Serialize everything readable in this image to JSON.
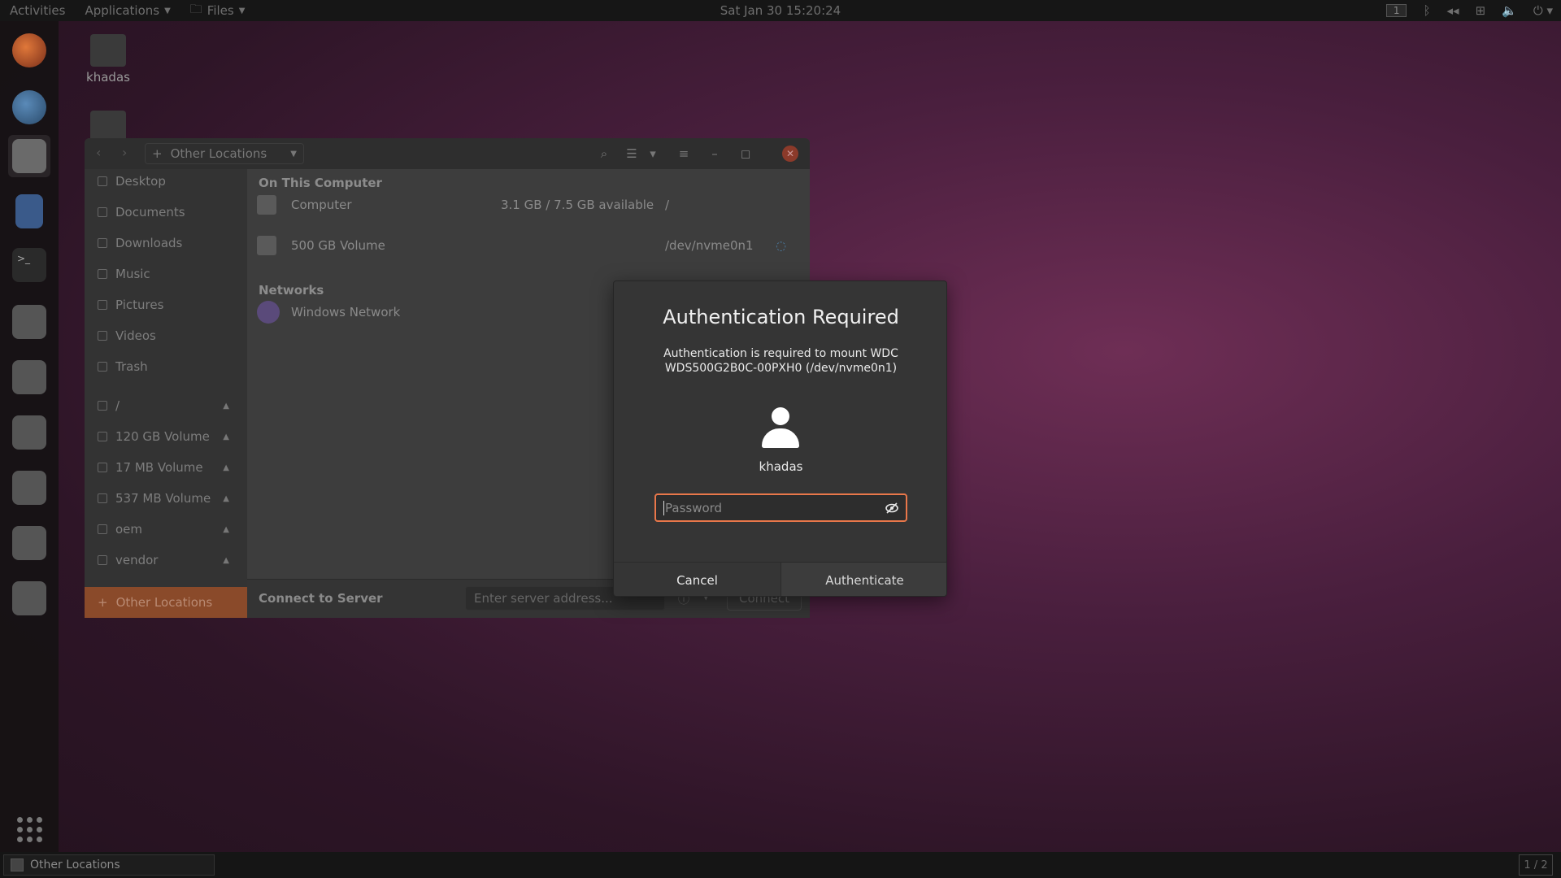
{
  "topbar": {
    "activities": "Activities",
    "applications": "Applications",
    "files": "Files",
    "clock": "Sat Jan 30  15:20:24",
    "workspace_badge": "1"
  },
  "desktop": {
    "home_icon_label": "khadas"
  },
  "file_manager": {
    "path_label": "Other Locations",
    "sidebar": [
      {
        "label": "Desktop",
        "eject": false
      },
      {
        "label": "Documents",
        "eject": false
      },
      {
        "label": "Downloads",
        "eject": false
      },
      {
        "label": "Music",
        "eject": false
      },
      {
        "label": "Pictures",
        "eject": false
      },
      {
        "label": "Videos",
        "eject": false
      },
      {
        "label": "Trash",
        "eject": false
      },
      {
        "label": "/",
        "eject": true
      },
      {
        "label": "120 GB Volume",
        "eject": true
      },
      {
        "label": "17 MB Volume",
        "eject": true
      },
      {
        "label": "537 MB Volume",
        "eject": true
      },
      {
        "label": "oem",
        "eject": true
      },
      {
        "label": "vendor",
        "eject": true
      }
    ],
    "other_locations_label": "Other Locations",
    "on_this_computer": "On This Computer",
    "computer": {
      "name": "Computer",
      "usage": "3.1 GB / 7.5 GB available",
      "mount": "/"
    },
    "volume": {
      "name": "500 GB Volume",
      "device": "/dev/nvme0n1"
    },
    "networks": "Networks",
    "windows_network": "Windows Network",
    "connect_to_server": "Connect to Server",
    "server_placeholder": "Enter server address...",
    "connect_button": "Connect"
  },
  "auth_dialog": {
    "title": "Authentication Required",
    "message": "Authentication is required to mount WDC WDS500G2B0C-00PXH0 (/dev/nvme0n1)",
    "username": "khadas",
    "password_placeholder": "Password",
    "cancel_label": "Cancel",
    "authenticate_label": "Authenticate"
  },
  "bottombar": {
    "task_label": "Other Locations",
    "workspace_pager": "1 / 2"
  },
  "colors": {
    "accent": "#e9774a",
    "dialog_bg": "#353535",
    "topbar_bg": "#161616"
  }
}
